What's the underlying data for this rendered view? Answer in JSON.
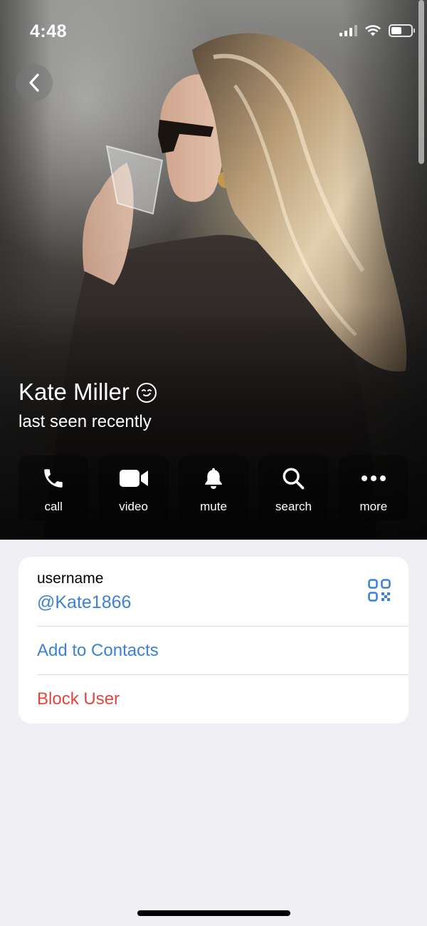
{
  "status_bar": {
    "time": "4:48"
  },
  "profile": {
    "name": "Kate Miller",
    "status": "last seen recently",
    "emoji_status_icon": "smirk-face-icon"
  },
  "actions": [
    {
      "label": "call",
      "icon": "phone-icon"
    },
    {
      "label": "video",
      "icon": "video-camera-icon"
    },
    {
      "label": "mute",
      "icon": "bell-icon"
    },
    {
      "label": "search",
      "icon": "search-icon"
    },
    {
      "label": "more",
      "icon": "more-dots-icon"
    }
  ],
  "info": {
    "username_label": "username",
    "username_value": "@Kate1866",
    "add_to_contacts": "Add to Contacts",
    "block_user": "Block User"
  },
  "colors": {
    "link_blue": "#3b82d6",
    "destructive_red": "#e0473c",
    "page_background": "#efeff4"
  }
}
